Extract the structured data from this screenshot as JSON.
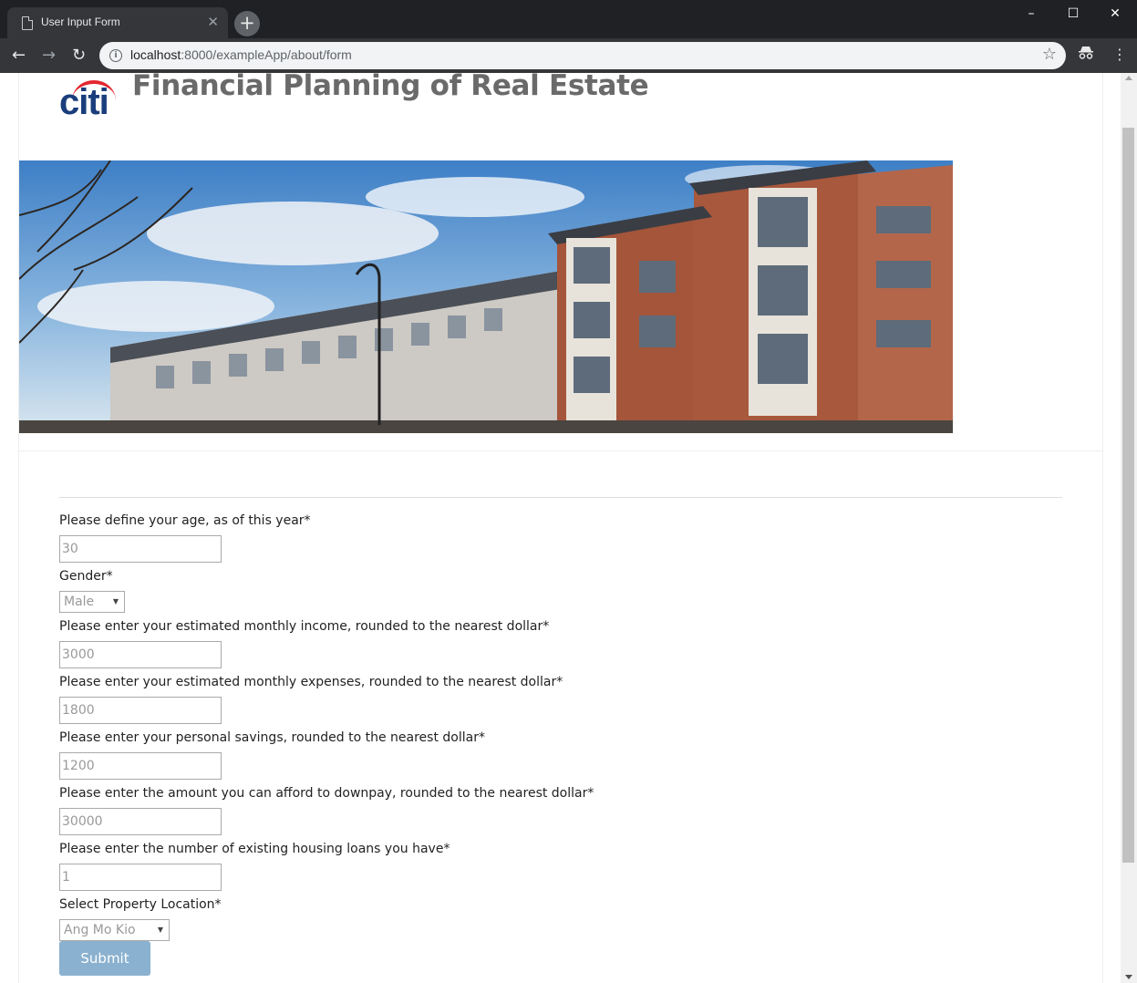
{
  "browser": {
    "tab_title": "User Input Form",
    "url_host": "localhost",
    "url_path": ":8000/exampleApp/about/form",
    "window_controls": {
      "minimize": "–",
      "maximize": "☐",
      "close": "✕"
    }
  },
  "header": {
    "logo_text": "citi",
    "title": "Financial Planning of Real Estate"
  },
  "form": {
    "fields": [
      {
        "label": "Please define your age, as of this year*",
        "value": "30"
      },
      {
        "label": "Gender*",
        "value": "Male"
      },
      {
        "label": "Please enter your estimated monthly income, rounded to the nearest dollar*",
        "value": "3000"
      },
      {
        "label": "Please enter your estimated monthly expenses, rounded to the nearest dollar*",
        "value": "1800"
      },
      {
        "label": "Please enter your personal savings, rounded to the nearest dollar*",
        "value": "1200"
      },
      {
        "label": "Please enter the amount you can afford to downpay, rounded to the nearest dollar*",
        "value": "30000"
      },
      {
        "label": "Please enter the number of existing housing loans you have*",
        "value": "1"
      },
      {
        "label": "Select Property Location*",
        "value": "Ang Mo Kio"
      }
    ],
    "submit_label": "Submit"
  },
  "colors": {
    "brand_blue": "#1a3d7c",
    "brand_red": "#e3262e",
    "submit_bg": "#8ab1cf",
    "title_gray": "#6a6a6a"
  }
}
